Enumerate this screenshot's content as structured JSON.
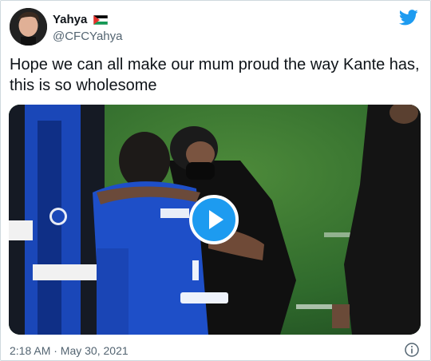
{
  "user": {
    "display_name": "Yahya",
    "handle": "@CFCYahya",
    "flag_icon": "palestine-flag-icon"
  },
  "tweet": {
    "text": "Hope we can all make our mum proud the way Kante has, this is so wholesome"
  },
  "media": {
    "type": "video",
    "play_icon": "play-icon"
  },
  "footer": {
    "timestamp": "2:18 AM · May 30, 2021",
    "info_icon": "info-icon"
  },
  "colors": {
    "twitter_blue": "#1d9bf0",
    "text_primary": "#0f1419",
    "text_secondary": "#536471",
    "border": "#cfd9de"
  }
}
